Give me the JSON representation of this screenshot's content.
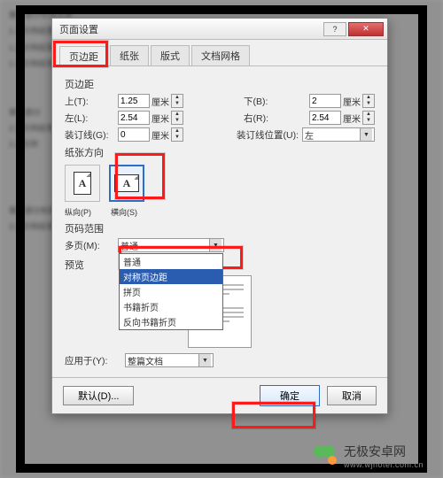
{
  "dialog": {
    "title": "页面设置",
    "tabs": [
      "页边距",
      "纸张",
      "版式",
      "文档网格"
    ],
    "margins_label": "页边距",
    "top_label": "上(T):",
    "bottom_label": "下(B):",
    "left_label": "左(L):",
    "right_label": "右(R):",
    "gutter_label": "装订线(G):",
    "gutter_pos_label": "装订线位置(U):",
    "top_val": "1.25",
    "bottom_val": "2",
    "left_val": "2.54",
    "right_val": "2.54",
    "gutter_val": "0",
    "unit": "厘米",
    "gutter_pos": "左",
    "orientation_label": "纸张方向",
    "portrait": "纵向(P)",
    "landscape": "横向(S)",
    "pages_label": "页码范围",
    "multi_label": "多页(M):",
    "multi_val": "普通",
    "dropdown_opts": [
      "普通",
      "对称页边距",
      "拼页",
      "书籍折页",
      "反向书籍折页"
    ],
    "preview_label": "预览",
    "apply_label": "应用于(Y):",
    "apply_val": "整篇文档",
    "default_btn": "默认(D)...",
    "ok_btn": "确定",
    "cancel_btn": "取消"
  },
  "watermark": {
    "text": "无极安卓网",
    "sub": "www.wjhotel.com.cn"
  }
}
